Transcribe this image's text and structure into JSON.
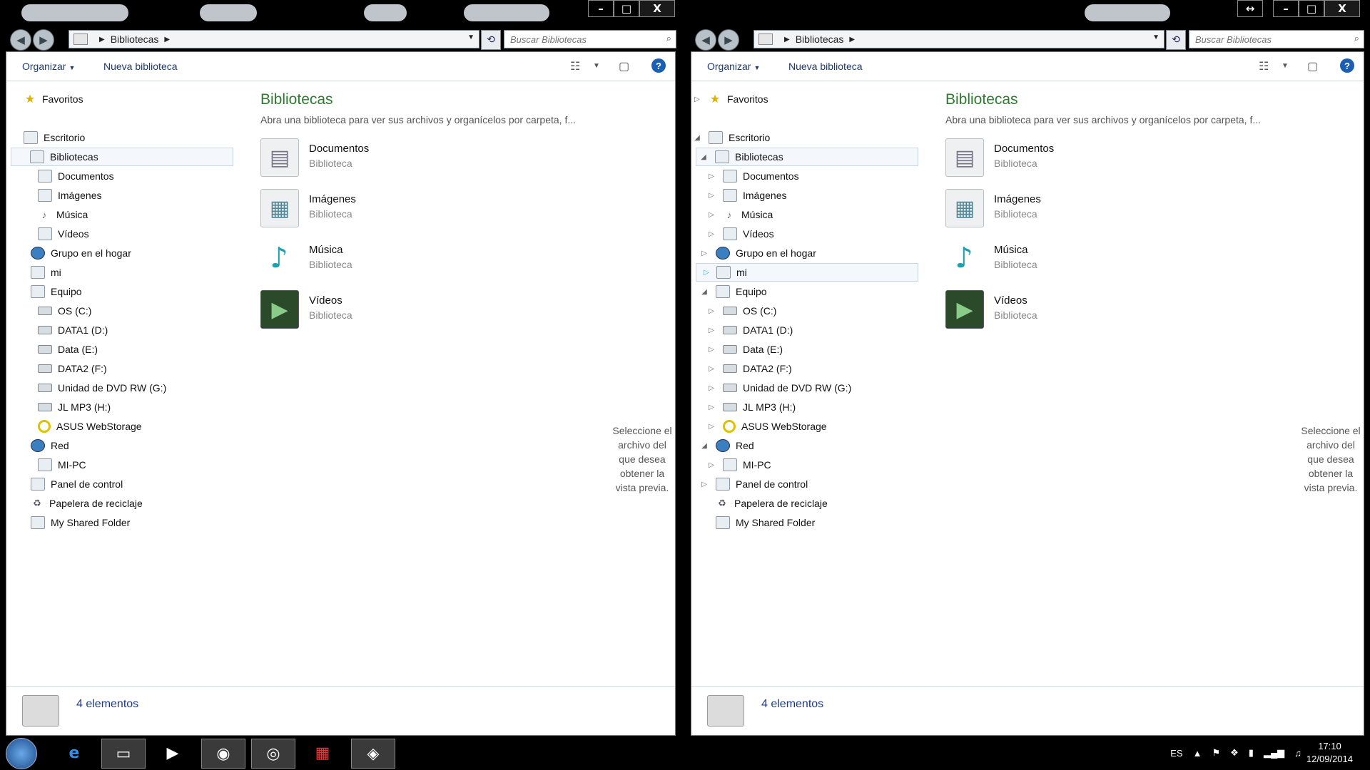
{
  "windows": [
    {
      "address": {
        "crumb": "Bibliotecas"
      },
      "search": {
        "placeholder": "Buscar Bibliotecas"
      },
      "commandbar": {
        "organize": "Organizar",
        "new_library": "Nueva biblioteca"
      },
      "nav": {
        "favorites": "Favoritos",
        "desktop": "Escritorio",
        "libraries": "Bibliotecas",
        "documents": "Documentos",
        "images": "Imágenes",
        "music": "Música",
        "videos": "Vídeos",
        "homegroup": "Grupo en el hogar",
        "user": "mi",
        "computer": "Equipo",
        "drive_c": "OS (C:)",
        "drive_d": "DATA1 (D:)",
        "drive_e": "Data (E:)",
        "drive_f": "DATA2 (F:)",
        "drive_g": "Unidad de DVD RW (G:)",
        "drive_h": "JL MP3 (H:)",
        "asus": "ASUS WebStorage",
        "network": "Red",
        "mipc": "MI-PC",
        "control": "Panel de control",
        "recycle": "Papelera de reciclaje",
        "shared": "My Shared Folder"
      },
      "main": {
        "title": "Bibliotecas",
        "subtitle": "Abra una biblioteca para ver sus archivos y organícelos por carpeta, f...",
        "libraries": [
          {
            "name": "Documentos",
            "type": "Biblioteca"
          },
          {
            "name": "Imágenes",
            "type": "Biblioteca"
          },
          {
            "name": "Música",
            "type": "Biblioteca"
          },
          {
            "name": "Vídeos",
            "type": "Biblioteca"
          }
        ],
        "preview_text": "Seleccione el archivo del que desea obtener la vista previa."
      },
      "status": {
        "count": "4 elementos"
      }
    },
    {
      "address": {
        "crumb": "Bibliotecas"
      },
      "search": {
        "placeholder": "Buscar Bibliotecas"
      },
      "commandbar": {
        "organize": "Organizar",
        "new_library": "Nueva biblioteca"
      },
      "nav": {
        "favorites": "Favoritos",
        "desktop": "Escritorio",
        "libraries": "Bibliotecas",
        "documents": "Documentos",
        "images": "Imágenes",
        "music": "Música",
        "videos": "Vídeos",
        "homegroup": "Grupo en el hogar",
        "user": "mi",
        "computer": "Equipo",
        "drive_c": "OS (C:)",
        "drive_d": "DATA1 (D:)",
        "drive_e": "Data (E:)",
        "drive_f": "DATA2 (F:)",
        "drive_g": "Unidad de DVD RW (G:)",
        "drive_h": "JL MP3 (H:)",
        "asus": "ASUS WebStorage",
        "network": "Red",
        "mipc": "MI-PC",
        "control": "Panel de control",
        "recycle": "Papelera de reciclaje",
        "shared": "My Shared Folder"
      },
      "main": {
        "title": "Bibliotecas",
        "subtitle": "Abra una biblioteca para ver sus archivos y organícelos por carpeta, f...",
        "libraries": [
          {
            "name": "Documentos",
            "type": "Biblioteca"
          },
          {
            "name": "Imágenes",
            "type": "Biblioteca"
          },
          {
            "name": "Música",
            "type": "Biblioteca"
          },
          {
            "name": "Vídeos",
            "type": "Biblioteca"
          }
        ],
        "preview_text": "Seleccione el archivo del que desea obtener la vista previa."
      },
      "status": {
        "count": "4 elementos"
      }
    }
  ],
  "taskbar": {
    "items": [
      "start-orb",
      "internet-explorer-icon",
      "explorer-icon",
      "media-player-icon",
      "chrome-icon",
      "app-icon",
      "tiles-app-icon",
      "app2-icon"
    ],
    "tray": {
      "language": "ES",
      "time": "17:10",
      "date": "12/09/2014"
    }
  },
  "colors": {
    "accent_title": "#2e7a30",
    "status_text": "#1e3a8a",
    "link": "#1e3a6a"
  }
}
